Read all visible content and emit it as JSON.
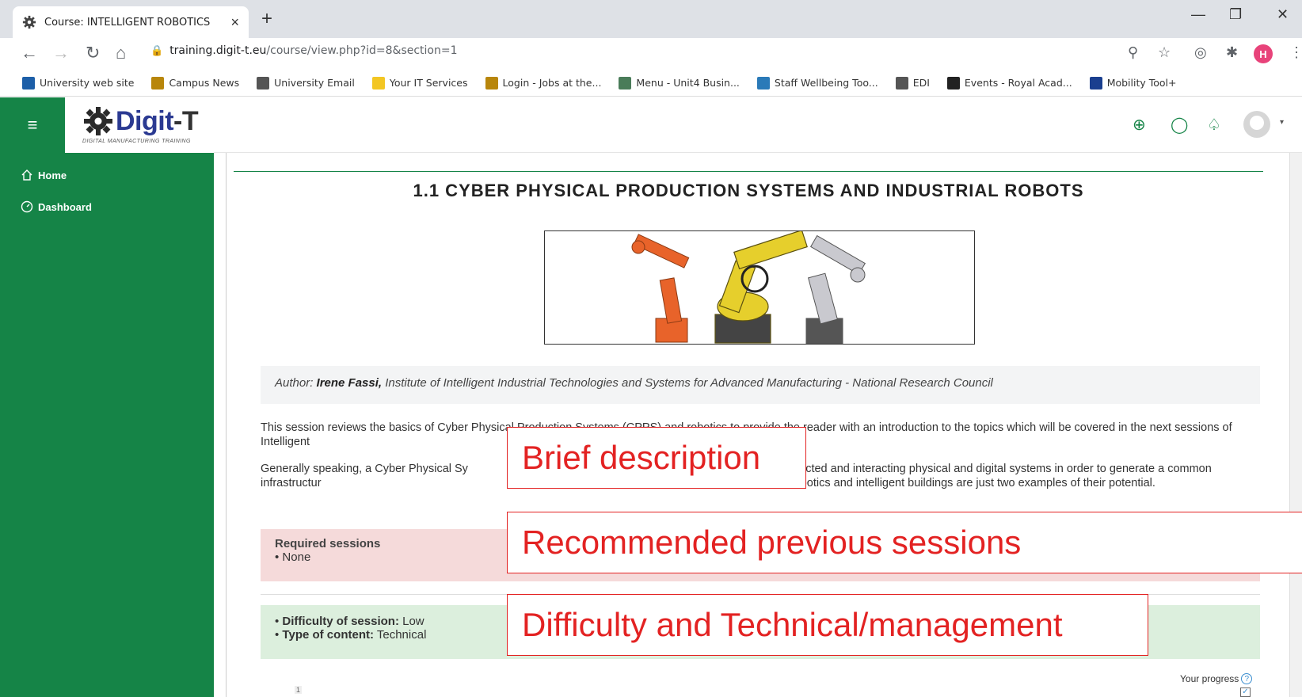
{
  "browser": {
    "tab_title": "Course: INTELLIGENT ROBOTICS",
    "new_tab": "+",
    "url_host": "training.digit-t.eu",
    "url_path": "/course/view.php?id=8&section=1",
    "avatar_letter": "H",
    "bookmarks": [
      {
        "label": "University web site",
        "color": "#1d5fa8"
      },
      {
        "label": "Campus News",
        "color": "#b8860b"
      },
      {
        "label": "University Email",
        "color": "#555555"
      },
      {
        "label": "Your IT Services",
        "color": "#f3c623"
      },
      {
        "label": "Login - Jobs at the...",
        "color": "#b8860b"
      },
      {
        "label": "Menu - Unit4 Busin...",
        "color": "#4a7c59"
      },
      {
        "label": "Staff Wellbeing Too...",
        "color": "#2a7ab8"
      },
      {
        "label": "EDI",
        "color": "#555555"
      },
      {
        "label": "Events - Royal Acad...",
        "color": "#222222"
      },
      {
        "label": "Mobility Tool+",
        "color": "#1a3f8f"
      }
    ]
  },
  "header": {
    "logo_main": "Digit",
    "logo_dash": "-T",
    "logo_sub": "DIGITAL MANUFACTURING TRAINING",
    "accent": "#158447"
  },
  "nav": {
    "home": "Home",
    "dashboard": "Dashboard"
  },
  "content": {
    "section_title": "1.1 CYBER PHYSICAL PRODUCTION SYSTEMS AND INDUSTRIAL ROBOTS",
    "author_label": "Author: ",
    "author_name": "Irene Fassi,",
    "author_affiliation": " Institute of Intelligent Industrial Technologies and Systems for Advanced Manufacturing - National Research Council",
    "para1": "This session reviews the basics of Cyber Physical Production Systems (CPPS) and robotics to provide the reader with an introduction to the topics which will be covered in the next sessions of Intelligent",
    "para2": "Generally speaking, a Cyber Physical Sy                                                                   sed of strictly interconnected and interacting physical and digital systems in order to generate a common infrastructur                                                                   f CPS in our everyday life is enormous. Advanced robotics and intelligent buildings are just two examples of their potential.",
    "required_heading": "Required sessions",
    "required_item": "None",
    "difficulty_label": "Difficulty of session:",
    "difficulty_value": " Low",
    "type_label": "Type of content:",
    "type_value": " Technical",
    "progress_label": "Your progress",
    "section_number": "1"
  },
  "annotations": {
    "brief": "Brief description",
    "recommended": "Recommended previous sessions",
    "difficulty": "Difficulty and Technical/management"
  }
}
